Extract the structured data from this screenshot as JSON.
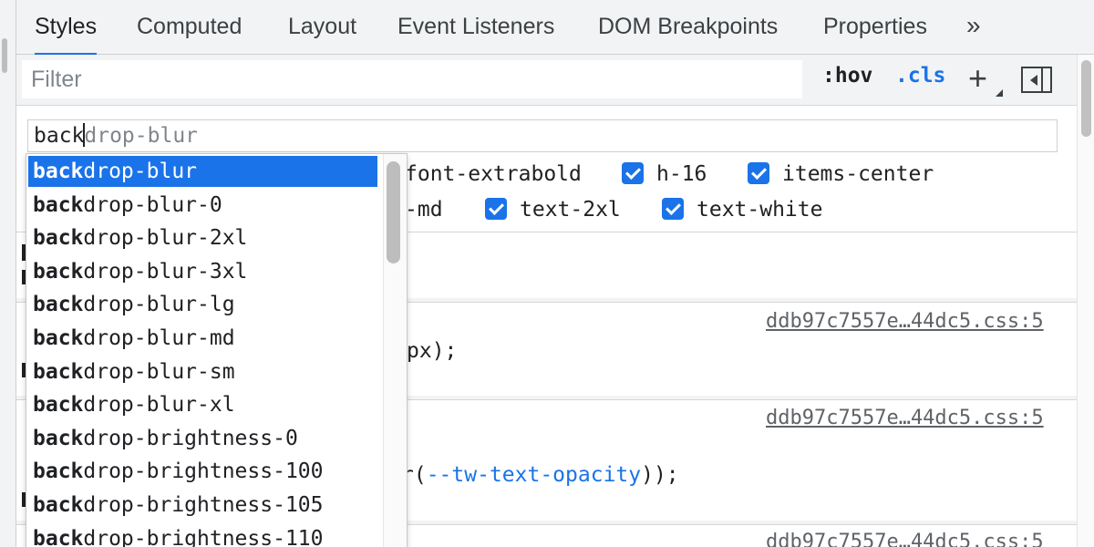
{
  "tabs": [
    {
      "label": "Styles",
      "active": true
    },
    {
      "label": "Computed"
    },
    {
      "label": "Layout"
    },
    {
      "label": "Event Listeners"
    },
    {
      "label": "DOM Breakpoints"
    },
    {
      "label": "Properties"
    }
  ],
  "tabs_more_label": "»",
  "toolbar": {
    "filter_placeholder": "Filter",
    "hov_label": ":hov",
    "cls_label": ".cls",
    "new_rule_label": "+"
  },
  "class_input": {
    "typed": "back",
    "completion": "drop-blur"
  },
  "class_list": [
    {
      "name": "font-extrabold",
      "checked": true,
      "show_checkbox": false
    },
    {
      "name": "h-16",
      "checked": true
    },
    {
      "name": "items-center",
      "checked": true
    },
    {
      "name": "-md",
      "checked": true,
      "show_checkbox": false
    },
    {
      "name": "text-2xl",
      "checked": true
    },
    {
      "name": "text-white",
      "checked": true
    }
  ],
  "rules": [
    {
      "source": "ddb97c7557e…44dc5.css:5",
      "fragment": "px);"
    },
    {
      "source": "ddb97c7557e…44dc5.css:5",
      "fragment_prefix": "r(",
      "fragment_var": "--tw-text-opacity",
      "fragment_suffix": "));"
    },
    {
      "source": "ddb97c7557e…44dc5.css:5"
    }
  ],
  "suggestions": {
    "match": "back",
    "selected_index": 0,
    "items": [
      {
        "match": "back",
        "rest": "drop-blur"
      },
      {
        "match": "back",
        "rest": "drop-blur-0"
      },
      {
        "match": "back",
        "rest": "drop-blur-2xl"
      },
      {
        "match": "back",
        "rest": "drop-blur-3xl"
      },
      {
        "match": "back",
        "rest": "drop-blur-lg"
      },
      {
        "match": "back",
        "rest": "drop-blur-md"
      },
      {
        "match": "back",
        "rest": "drop-blur-sm"
      },
      {
        "match": "back",
        "rest": "drop-blur-xl"
      },
      {
        "match": "back",
        "rest": "drop-brightness-0"
      },
      {
        "match": "back",
        "rest": "drop-brightness-100"
      },
      {
        "match": "back",
        "rest": "drop-brightness-105"
      },
      {
        "match": "back",
        "rest": "drop-brightness-110"
      }
    ]
  },
  "colors": {
    "accent": "#1a73e8",
    "panel": "#f1f3f4"
  }
}
